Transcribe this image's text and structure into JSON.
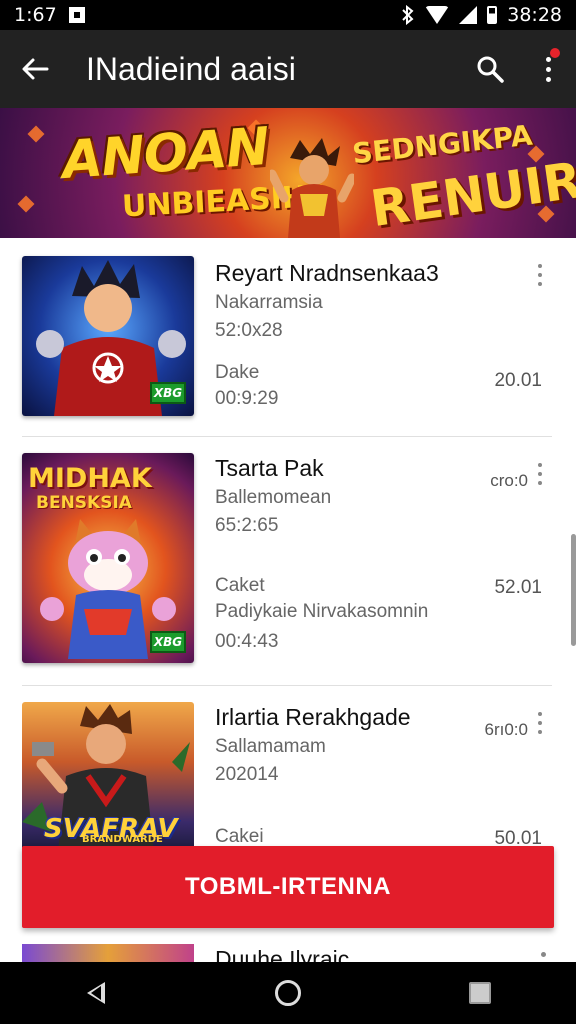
{
  "status_bar": {
    "time": "1:67",
    "clock": "38:28"
  },
  "app_bar": {
    "title": "INadieind aaisi",
    "back_icon": "arrow-back-icon",
    "search_icon": "search-icon",
    "more_icon": "more-vert-icon",
    "badge_color": "#e8232b"
  },
  "banner": {
    "line1": "ANOAN",
    "line2": "UNBIEASIHA",
    "line3": "SEDNGIKPA",
    "line4": "RENUIR!"
  },
  "items": [
    {
      "name": "Reyart Nradnsenkaa3",
      "subtitle": "Nakarramsia",
      "number": "52:0x28",
      "label": "Dake",
      "time": "00:9:29",
      "value": "20.01",
      "thumb_tag": "XBG",
      "thumb_text": ""
    },
    {
      "name": "Tsarta Pak",
      "subtitle": "Ballemomean",
      "number": "65:2:65",
      "label": "Caket",
      "description": "Padiykaie Nirvakasomnin",
      "time": "00:4:43",
      "value": "52.01",
      "small_value": "cro:0",
      "thumb_tag": "XBG",
      "thumb_text_1": "MIDHAK",
      "thumb_text_2": "BENSKSIA"
    },
    {
      "name": "Irlartia Rerakhgade",
      "subtitle": "Sallamamam",
      "number": "202014",
      "label": "Cakei",
      "value": "50.01",
      "small_value": "6rı0:0",
      "thumb_text_1": "SVAFRAV",
      "thumb_text_2": "BRANDWARDE"
    }
  ],
  "cta_button": {
    "label": "TOBML-IRTENNA",
    "color": "#e21d2a"
  },
  "peek_item": {
    "name": "Duuhe Ilyraic"
  },
  "nav_bar": {
    "back_icon": "nav-back-icon",
    "home_icon": "nav-home-icon",
    "recents_icon": "nav-recents-icon"
  }
}
